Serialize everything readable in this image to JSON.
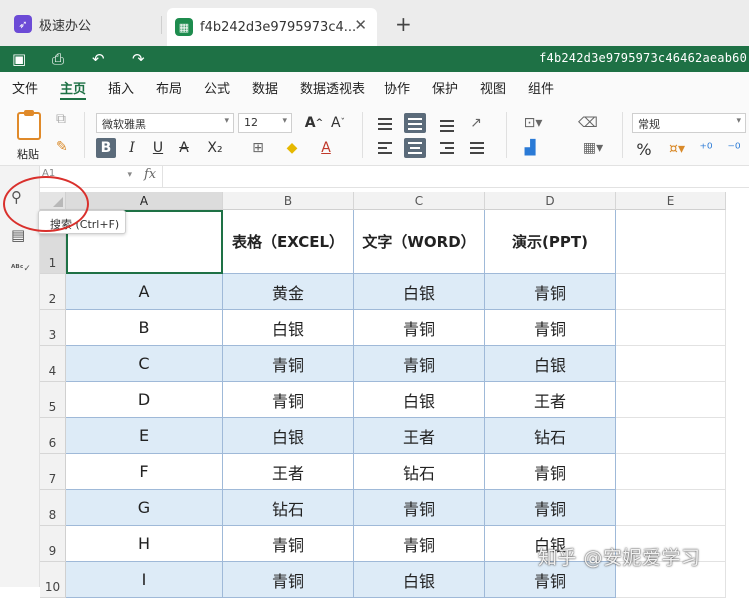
{
  "tabs": [
    {
      "label": "极速办公"
    },
    {
      "label": "f4b242d3e9795973c4..."
    }
  ],
  "tab_close_glyph": "✕",
  "tab_add_glyph": "+",
  "titlebar": {
    "doc_name": "f4b242d3e9795973c46462aeab60"
  },
  "menu": [
    "文件",
    "主页",
    "插入",
    "布局",
    "公式",
    "数据",
    "数据透视表",
    "协作",
    "保护",
    "视图",
    "组件"
  ],
  "ribbon": {
    "paste_label": "粘贴",
    "font_name": "微软雅黑",
    "font_size": "12",
    "number_format": "常规",
    "bold": "B",
    "italic": "I",
    "underline": "U",
    "strike": "A",
    "subscript": "X₂",
    "grow_font": "A",
    "shrink_font": "A",
    "font_color": "A",
    "percent": "%"
  },
  "formula_bar": {
    "name_box": "A1",
    "fx": "fx"
  },
  "tooltip": "搜索 (Ctrl+F)",
  "grid": {
    "columns": [
      "A",
      "B",
      "C",
      "D",
      "E"
    ],
    "rows": [
      "1",
      "2",
      "3",
      "4",
      "5",
      "6",
      "7",
      "8",
      "9",
      "10"
    ],
    "headers": [
      "",
      "表格（EXCEL）",
      "文字（WORD）",
      "演示(PPT)"
    ],
    "data": [
      [
        "A",
        "黄金",
        "白银",
        "青铜"
      ],
      [
        "B",
        "白银",
        "青铜",
        "青铜"
      ],
      [
        "C",
        "青铜",
        "青铜",
        "白银"
      ],
      [
        "D",
        "青铜",
        "白银",
        "王者"
      ],
      [
        "E",
        "白银",
        "王者",
        "钻石"
      ],
      [
        "F",
        "王者",
        "钻石",
        "青铜"
      ],
      [
        "G",
        "钻石",
        "青铜",
        "青铜"
      ],
      [
        "H",
        "青铜",
        "青铜",
        "白银"
      ],
      [
        "I",
        "青铜",
        "白银",
        "青铜"
      ]
    ]
  },
  "watermark": "知乎 @安妮爱学习",
  "colors": {
    "accent": "#1e7145",
    "band": "#ddebf7",
    "annotation": "#d9302c",
    "tab_icon": "#6c4bd6"
  }
}
